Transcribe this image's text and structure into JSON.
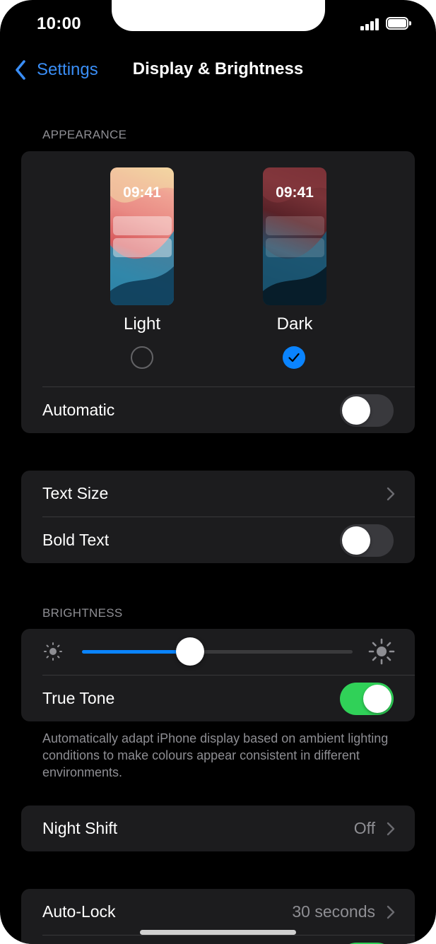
{
  "status_bar": {
    "time": "10:00"
  },
  "nav": {
    "back_label": "Settings",
    "title": "Display & Brightness"
  },
  "appearance": {
    "header": "APPEARANCE",
    "light": {
      "clock": "09:41",
      "label": "Light",
      "selected": false
    },
    "dark": {
      "clock": "09:41",
      "label": "Dark",
      "selected": true
    },
    "automatic_label": "Automatic",
    "automatic_on": false
  },
  "text_group": {
    "text_size_label": "Text Size",
    "bold_text_label": "Bold Text",
    "bold_text_on": false
  },
  "brightness": {
    "header": "BRIGHTNESS",
    "level": 0.4,
    "true_tone_label": "True Tone",
    "true_tone_on": true,
    "footnote": "Automatically adapt iPhone display based on ambient lighting conditions to make colours appear consistent in different environments."
  },
  "night_shift": {
    "label": "Night Shift",
    "value": "Off"
  },
  "auto_lock": {
    "label": "Auto-Lock",
    "value": "30 seconds"
  },
  "colors": {
    "accent": "#0a84ff",
    "back_link": "#3a8ef6",
    "toggle_on": "#30d158",
    "cell_bg": "#1c1c1e"
  }
}
